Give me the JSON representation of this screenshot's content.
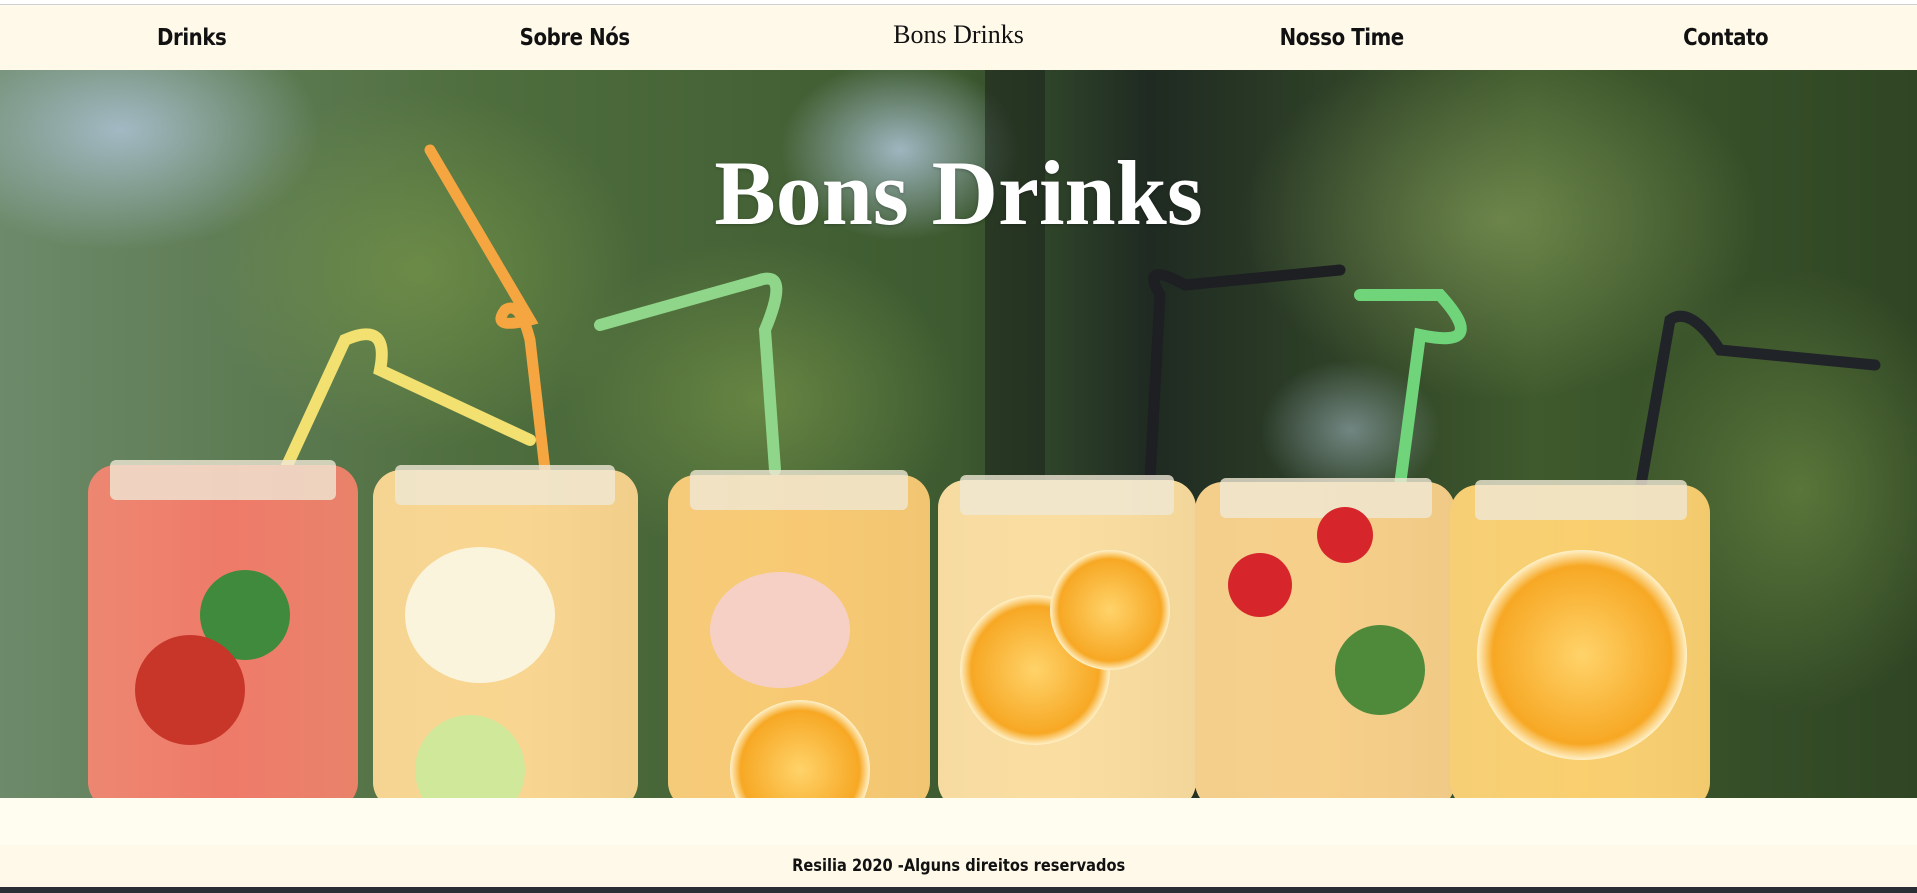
{
  "nav": {
    "items": [
      {
        "label": "Drinks"
      },
      {
        "label": "Sobre Nós"
      },
      {
        "label": "Nosso Time"
      },
      {
        "label": "Contato"
      }
    ],
    "brand": "Bons Drinks"
  },
  "hero": {
    "title": "Bons Drinks",
    "image": "infused-water-jars-with-straws"
  },
  "footer": {
    "text": "Resilia 2020 -Alguns direitos reservados"
  },
  "colors": {
    "nav_background": "#fff9ea",
    "page_background": "#fffcf0",
    "hero_title": "#ffffff",
    "bottom_bar": "#2a2f36"
  }
}
